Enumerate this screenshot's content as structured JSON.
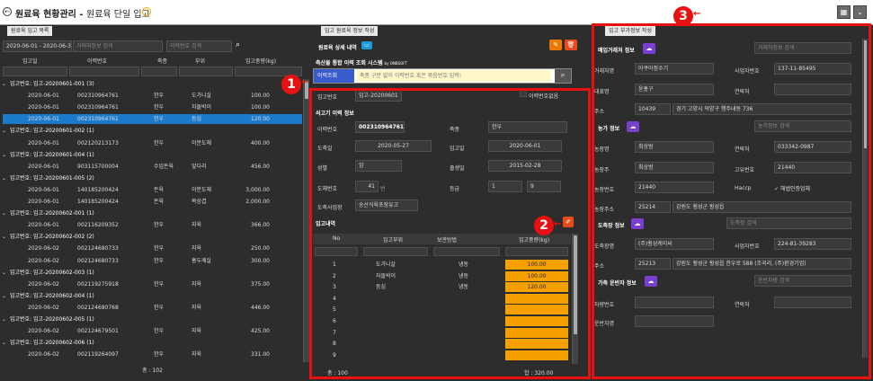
{
  "app": {
    "title": "원료육 현황관리",
    "subtitle": "원료육 단일 입고",
    "back_icon": "←",
    "info_icon": "!",
    "grid_icon": "▦",
    "dropdown_icon": "⌄"
  },
  "left": {
    "tab": "원료육 입고 목록",
    "date_range": "2020-06-01 - 2020-06-30",
    "trace_placeholder": "거래처정보 검색",
    "lot_placeholder": "이력번호 검색",
    "columns": [
      "입고일",
      "이력번호",
      "축종",
      "부위",
      "입고중량(kg)"
    ],
    "rows": [
      {
        "type": "group",
        "label": "입고번호: 입고-20200601-001 (3)"
      },
      {
        "type": "item",
        "date": "2020-06-01",
        "lot": "002310964761",
        "kind": "한우",
        "part": "도가니살",
        "weight": "100.00"
      },
      {
        "type": "item",
        "date": "2020-06-01",
        "lot": "002310964761",
        "kind": "한우",
        "part": "자돌박이",
        "weight": "100.00"
      },
      {
        "type": "item",
        "date": "2020-06-01",
        "lot": "002310964761",
        "kind": "한우",
        "part": "등심",
        "weight": "120.00",
        "selected": true
      },
      {
        "type": "group",
        "label": "입고번호: 입고-20200601-002 (1)"
      },
      {
        "type": "item",
        "date": "2020-06-01",
        "lot": "002120213173",
        "kind": "한우",
        "part": "이분도체",
        "weight": "400.00"
      },
      {
        "type": "group",
        "label": "입고번호: 입고-20200601-004 (1)"
      },
      {
        "type": "item",
        "date": "2020-06-01",
        "lot": "903115700004",
        "kind": "수입돈육",
        "part": "앞다리",
        "weight": "456.00"
      },
      {
        "type": "group",
        "label": "입고번호: 입고-20200601-005 (2)"
      },
      {
        "type": "item",
        "date": "2020-06-01",
        "lot": "140185200424",
        "kind": "돈육",
        "part": "이분도체",
        "weight": "3,000.00"
      },
      {
        "type": "item",
        "date": "2020-06-01",
        "lot": "140185200424",
        "kind": "돈육",
        "part": "목삼겹",
        "weight": "2,000.00"
      },
      {
        "type": "group",
        "label": "입고번호: 입고-20200602-001 (1)"
      },
      {
        "type": "item",
        "date": "2020-06-01",
        "lot": "002116209352",
        "kind": "한우",
        "part": "지육",
        "weight": "366.00"
      },
      {
        "type": "group",
        "label": "입고번호: 입고-20200602-002 (2)"
      },
      {
        "type": "item",
        "date": "2020-06-02",
        "lot": "002124680733",
        "kind": "한우",
        "part": "지육",
        "weight": "250.00"
      },
      {
        "type": "item",
        "date": "2020-06-02",
        "lot": "002124680733",
        "kind": "한우",
        "part": "홍두깨살",
        "weight": "300.00"
      },
      {
        "type": "group",
        "label": "입고번호: 입고-20200602-003 (1)"
      },
      {
        "type": "item",
        "date": "2020-06-02",
        "lot": "002119275918",
        "kind": "한우",
        "part": "지육",
        "weight": "375.00"
      },
      {
        "type": "group",
        "label": "입고번호: 입고-20200602-004 (1)"
      },
      {
        "type": "item",
        "date": "2020-06-02",
        "lot": "002124680768",
        "kind": "한우",
        "part": "지육",
        "weight": "446.00"
      },
      {
        "type": "group",
        "label": "입고번호: 입고-20200602-005 (1)"
      },
      {
        "type": "item",
        "date": "2020-06-02",
        "lot": "002124679501",
        "kind": "한우",
        "part": "지육",
        "weight": "425.00"
      },
      {
        "type": "group",
        "label": "입고번호: 입고-20200602-006 (1)"
      },
      {
        "type": "item",
        "date": "2020-06-02",
        "lot": "002119264097",
        "kind": "한우",
        "part": "지육",
        "weight": "331.00"
      }
    ],
    "total": "총 : 102"
  },
  "mid": {
    "tab": "입고 원료육 정보 작성",
    "detail_label": "원료육 상세 내역",
    "system_name": "축산물 통합 이력 조회 시스템",
    "system_by": "by ONBSOFT",
    "trace_btn": "이력조회",
    "trace_placeholder": "축종 구분 없이 이력번호 혹은 묶음번호 입력!",
    "inbound_no_label": "입고번호",
    "inbound_no": "입고-20200601",
    "no_lot_label": "이력번호없음",
    "beef_info_label": "쇠고기 이력 정보",
    "lot_label": "이력번호",
    "lot": "002310964761",
    "kind_label": "축종",
    "kind": "한우",
    "slaughter_label": "도축일",
    "slaughter": "2020-05-27",
    "inbound_date_label": "입고일",
    "inbound_date": "2020-06-01",
    "sex_label": "성별",
    "sex": "암",
    "birth_label": "출생일",
    "birth": "2015-02-28",
    "carcass_label": "도체번호",
    "carcass": "41",
    "carcass_unit": "번",
    "grade_label": "등급",
    "grade1": "1",
    "grade2": "9",
    "plant_label": "도축사업장",
    "plant": "송산식육포장유고",
    "history_label": "입고내역",
    "cols": [
      "No",
      "입고부위",
      "보관방법",
      "입고중량(kg)"
    ],
    "items": [
      {
        "no": "1",
        "part": "도가니살",
        "store": "냉동",
        "weight": "100.00"
      },
      {
        "no": "2",
        "part": "자돌박이",
        "store": "냉동",
        "weight": "100.00"
      },
      {
        "no": "3",
        "part": "등심",
        "store": "냉동",
        "weight": "120.00"
      },
      {
        "no": "4",
        "part": "",
        "store": "",
        "weight": ""
      },
      {
        "no": "5",
        "part": "",
        "store": "",
        "weight": ""
      },
      {
        "no": "6",
        "part": "",
        "store": "",
        "weight": ""
      },
      {
        "no": "7",
        "part": "",
        "store": "",
        "weight": ""
      },
      {
        "no": "8",
        "part": "",
        "store": "",
        "weight": ""
      },
      {
        "no": "9",
        "part": "",
        "store": "",
        "weight": ""
      }
    ],
    "total_count": "총 : 100",
    "total_weight": "합 : 320.00"
  },
  "right": {
    "tab": "입고 부가정보 작성",
    "buyer_label": "매입거래처 정보",
    "buyer_search": "거래처정보 검색",
    "company_label": "거래처명",
    "company": "아쿠아정수기",
    "bizno_label": "사업자번호",
    "bizno": "137-11-85495",
    "ceo_label": "대표명",
    "ceo": "윤홍구",
    "contact_label": "연락처",
    "contact": "",
    "addr_label": "주소",
    "zip": "10439",
    "addr": "경기 고양시 덕양구 행주내동 736",
    "farm_label": "농가 정보",
    "farm_search": "농가정보 검색",
    "farm_name_label": "농장명",
    "farm_name": "최상범",
    "farm_phone_label": "연락처",
    "farm_phone": "033342-0987",
    "farm_owner_label": "농장주",
    "farm_owner": "최상범",
    "farm_id_label": "고유번호",
    "farm_id": "21440",
    "farm_no_label": "농장번호",
    "farm_no": "21440",
    "haccp_label": "Haccp",
    "haccp_value": "✓ 해썹인증업체",
    "farm_addr_label": "농장주소",
    "farm_zip": "25214",
    "farm_addr": "강원도 횡성군 횡성읍",
    "slaughter_label": "도축장 정보",
    "slaughter_search": "도축장 검색",
    "sl_name_label": "도축장명",
    "sl_name": "(주)횡성케이씨",
    "sl_biz_label": "사업자번호",
    "sl_biz": "224-81-39283",
    "sl_addr_label": "주소",
    "sl_zip": "25213",
    "sl_addr": "강원도 횡성군 횡성읍 한우로 588 (조곡리, (주)환경기업)",
    "carrier_label": "가축 운반자 정보",
    "carrier_search": "운반차량 검색",
    "car_no_label": "차량번호",
    "car_contact_label": "연락처",
    "driver_label": "운반자명"
  },
  "badges": {
    "b1": "1",
    "b2": "2",
    "b3": "3"
  },
  "colors": {
    "accent_red": "#e81010",
    "purple": "#7a3fd1",
    "orange": "#f07a00",
    "selected": "#1c7acb",
    "weight_cell": "#f6a000"
  }
}
